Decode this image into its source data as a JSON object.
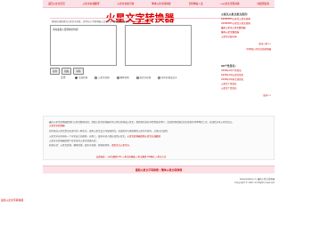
{
  "nav": [
    "返回火星文首页",
    "火星文在线翻译",
    "火星文在线字典",
    "繁体火星文转换器",
    "日韩繁输入法",
    "ω火星文流程转换",
    "叫妞姐表情"
  ],
  "title": "火星文字转换器",
  "intro": {
    "text": "我国在球转换为火星文字系统，您可在以下框中输入汉字，即可转换成火星文字。",
    "link": "火星文字在线翻译"
  },
  "input_placeholder": "请在此输入要转换的内容",
  "buttons": {
    "convert": "复制",
    "copy": "粘贴",
    "clear": "清除"
  },
  "radios": {
    "label": "选择:",
    "options": [
      "全部转换",
      "火星文转换",
      "繁体转换",
      "颜文字转换",
      "简字转换成汉字"
    ]
  },
  "side": {
    "box1_title": "火星文火星文星文资讯:",
    "box1_items": [
      "20080825火星文火星文转换",
      "20080825火星文火星文转换",
      "最新火星文火星文翻译器",
      "繁体火星文翻译器",
      "火星文在线字典"
    ],
    "box1_more": "更多火星>>",
    "box1_more2": "QQ网名火星文在线转换器",
    "box2_title": "90个性签名:",
    "box2_items": [
      "2008年QQ个性签名",
      "2008年QQ火星文签名",
      "2008年QQ非主流签名",
      "火星文个性签名",
      "火星文个性签名"
    ],
    "box2_more": "更多>>"
  },
  "info": {
    "p1": "    最好火星文转换器是我们火星文翻译站的，需要火星文转换器的可以把它转换成火星文，把转换文章分享给到更多用户，欢迎您把转换后的文章保存到本网页上也，欢迎您分享火星文站点。",
    "p1b": "火星文字转换器",
    "p2": "因为目前火星文是比较流行的一种文字，使用火星文会让你更加时尚，欢迎您可以把转换的火星文字保存，方便以后使用。",
    "p3": "    火星文字在中国有一个非常庞大的群体，在网上，很多年轻人都在使用火星文，",
    "p3b": "火星文转换器提供火星文在线翻译",
    "p3c": "火星文字转换器提供了非常多的火星文转换方式，",
    "p4": "  转换方式：火星文转换、繁体转换、颜文字转换、简体转换等。",
    "p4b": "请您关注火星文字。"
  },
  "foot_links": "友情链接：火星文翻译  QQ  火星文转换器  火星文翻译  QQ网名  火星文大全",
  "bar": "最新火星文字转换器 | 繁体火星文转换器",
  "copyright": {
    "line1": "www.zealpen.cn  最新火星文转换器",
    "line2": "Copyright © 2007 All Rights reserved"
  },
  "corner": "最新火星文字转换器"
}
